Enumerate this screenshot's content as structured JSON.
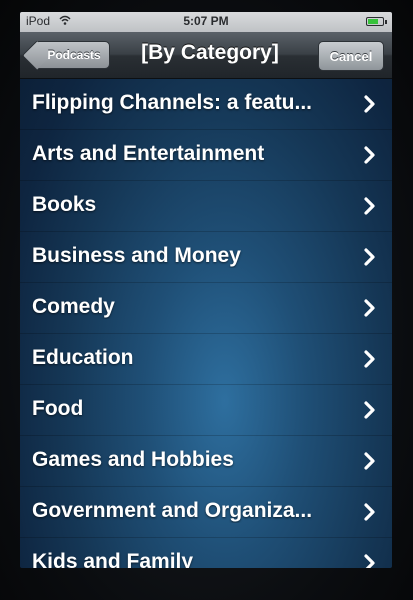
{
  "status_bar": {
    "carrier": "iPod",
    "time": "5:07 PM",
    "battery_level": 0.7
  },
  "nav": {
    "back_label": "Podcasts",
    "title": "[By Category]",
    "cancel_label": "Cancel"
  },
  "categories": [
    "Flipping Channels: a featu...",
    "Arts and Entertainment",
    "Books",
    "Business and Money",
    "Comedy",
    "Education",
    "Food",
    "Games and Hobbies",
    "Government and Organiza...",
    "Kids and Family"
  ],
  "colors": {
    "background_accent": "#2e6f9f",
    "text": "#ffffff"
  }
}
